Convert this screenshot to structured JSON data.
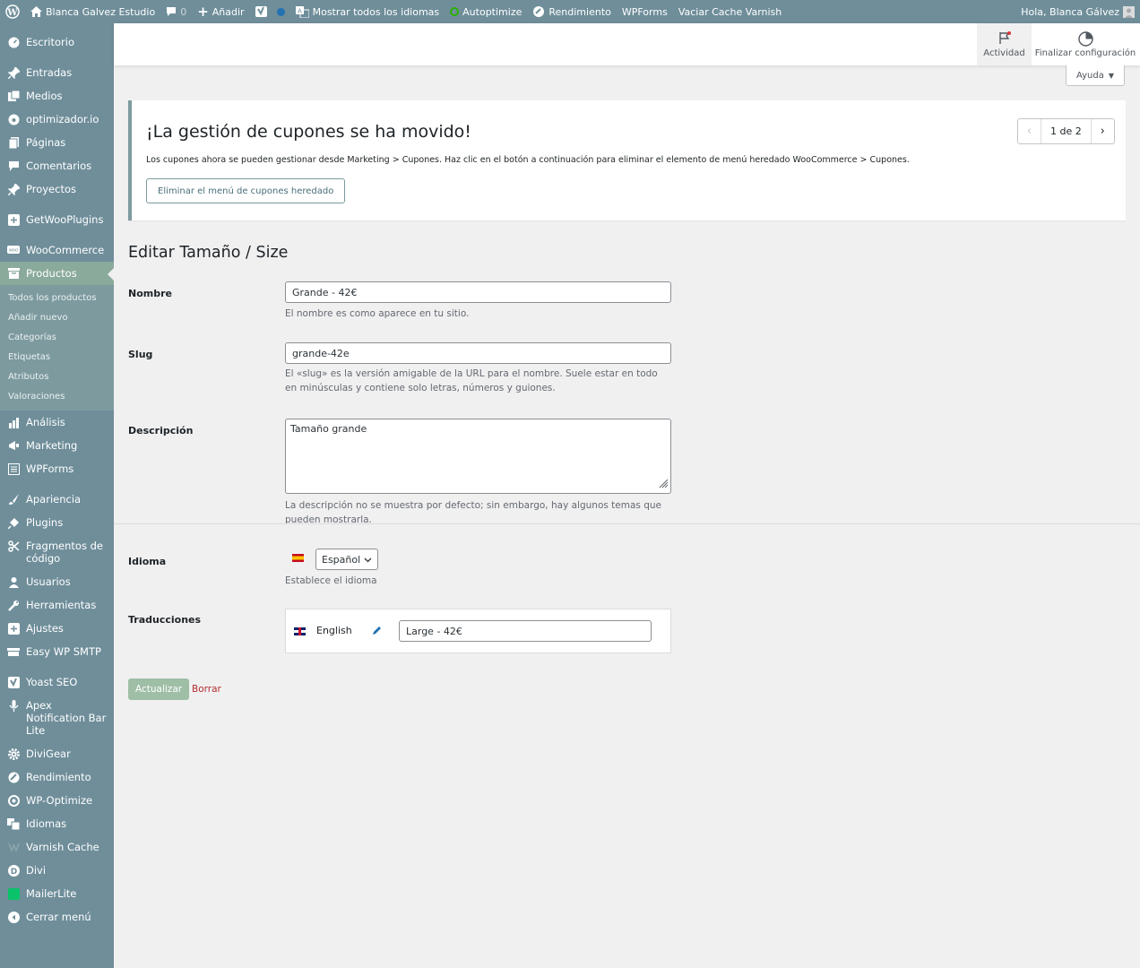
{
  "adminbar": {
    "site_name": "Blanca Galvez Estudio",
    "comments_count": "0",
    "add_new": "Añadir",
    "show_languages": "Mostrar todos los idiomas",
    "autoptimize": "Autoptimize",
    "performance": "Rendimiento",
    "wpforms": "WPForms",
    "varnish": "Vaciar Cache Varnish",
    "greeting": "Hola, Blanca Gálvez"
  },
  "sidebar": {
    "dashboard": "Escritorio",
    "posts": "Entradas",
    "media": "Medios",
    "optimizador": "optimizador.io",
    "pages": "Páginas",
    "comments": "Comentarios",
    "projects": "Proyectos",
    "getwooplugins": "GetWooPlugins",
    "woocommerce": "WooCommerce",
    "products": "Productos",
    "submenu": [
      "Todos los productos",
      "Añadir nuevo",
      "Categorías",
      "Etiquetas",
      "Atributos",
      "Valoraciones"
    ],
    "analytics": "Análisis",
    "marketing": "Marketing",
    "wpforms": "WPForms",
    "appearance": "Apariencia",
    "plugins": "Plugins",
    "snippets": "Fragmentos de código",
    "users": "Usuarios",
    "tools": "Herramientas",
    "settings": "Ajustes",
    "smtp": "Easy WP SMTP",
    "yoast": "Yoast SEO",
    "apex": "Apex Notification Bar Lite",
    "divigear": "DiviGear",
    "performance": "Rendimiento",
    "wpoptimize": "WP-Optimize",
    "languages": "Idiomas",
    "varnish": "Varnish Cache",
    "divi": "Divi",
    "mailerlite": "MailerLite",
    "collapse": "Cerrar menú"
  },
  "topbar": {
    "activity": "Actividad",
    "finish_setup": "Finalizar configuración",
    "help": "Ayuda"
  },
  "notice": {
    "title": "¡La gestión de cupones se ha movido!",
    "text": "Los cupones ahora se pueden gestionar desde Marketing > Cupones. Haz clic en el botón a continuación para eliminar el elemento de menú heredado WooCommerce > Cupones.",
    "button": "Eliminar el menú de cupones heredado",
    "pager": "1 de 2"
  },
  "form": {
    "page_title": "Editar Tamaño / Size",
    "name_label": "Nombre",
    "name_value": "Grande - 42€",
    "name_desc": "El nombre es como aparece en tu sitio.",
    "slug_label": "Slug",
    "slug_value": "grande-42e",
    "slug_desc": "El «slug» es la versión amigable de la URL para el nombre. Suele estar en todo en minúsculas y contiene solo letras, números y guiones.",
    "desc_label": "Descripción",
    "desc_value": "Tamaño grande",
    "desc_help": "La descripción no se muestra por defecto; sin embargo, hay algunos temas que pueden mostrarla.",
    "lang_label": "Idioma",
    "lang_value": "Español",
    "lang_desc": "Establece el idioma",
    "trans_label": "Traducciones",
    "trans_lang": "English",
    "trans_value": "Large - 42€",
    "update": "Actualizar",
    "delete": "Borrar"
  },
  "colors": {
    "adminbar_bg": "#6f8e9a",
    "sidebar_bg": "#6f8e9a",
    "submenu_bg": "#7d9a9f",
    "current_item_bg": "#8aaa9c",
    "button_primary": "#9fbea6",
    "delete_link": "#b32d2e"
  }
}
